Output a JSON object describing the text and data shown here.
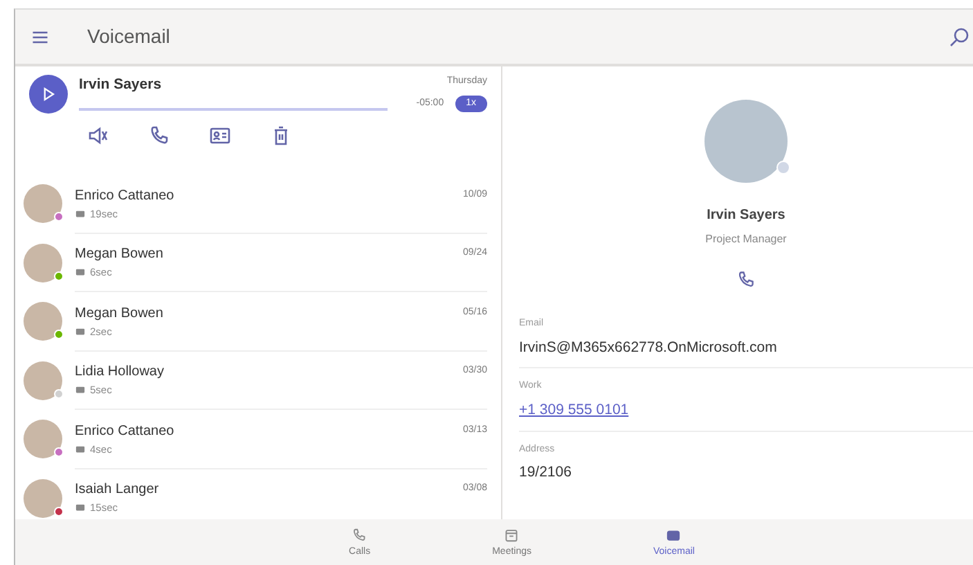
{
  "header": {
    "title": "Voicemail"
  },
  "player": {
    "name": "Irvin Sayers",
    "day": "Thursday",
    "remaining": "-05:00",
    "speed": "1x"
  },
  "voicemails": [
    {
      "name": "Enrico Cattaneo",
      "duration": "19sec",
      "date": "10/09",
      "color": "#c76fc0"
    },
    {
      "name": "Megan Bowen",
      "duration": "6sec",
      "date": "09/24",
      "color": "#6bb700"
    },
    {
      "name": "Megan Bowen",
      "duration": "2sec",
      "date": "05/16",
      "color": "#6bb700"
    },
    {
      "name": "Lidia Holloway",
      "duration": "5sec",
      "date": "03/30",
      "color": "#d1d1d1"
    },
    {
      "name": "Enrico Cattaneo",
      "duration": "4sec",
      "date": "03/13",
      "color": "#c76fc0"
    },
    {
      "name": "Isaiah Langer",
      "duration": "15sec",
      "date": "03/08",
      "color": "#c4314b"
    }
  ],
  "contact": {
    "name": "Irvin Sayers",
    "role": "Project Manager",
    "color": "#d1d8e6",
    "fields": [
      {
        "label": "Email",
        "value": "IrvinS@M365x662778.OnMicrosoft.com",
        "kind": "text"
      },
      {
        "label": "Work",
        "value": "+1 309 555 0101",
        "kind": "link"
      },
      {
        "label": "Address",
        "value": "19/2106",
        "kind": "text"
      }
    ]
  },
  "nav": [
    {
      "label": "Calls",
      "kind": "calls",
      "selected": false
    },
    {
      "label": "Meetings",
      "kind": "meetings",
      "selected": false
    },
    {
      "label": "Voicemail",
      "kind": "voicemail",
      "selected": true
    }
  ]
}
